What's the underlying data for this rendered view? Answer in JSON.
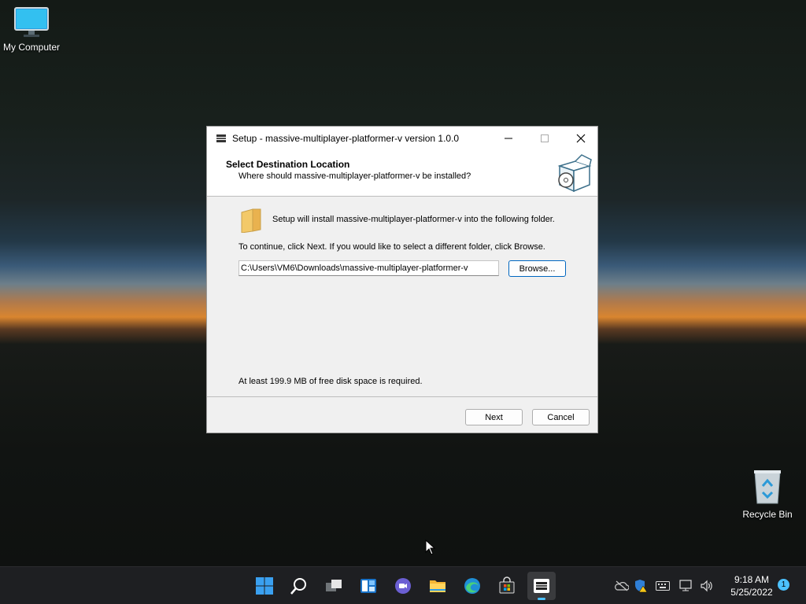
{
  "desktop": {
    "icons": [
      {
        "label": "My Computer",
        "icon": "monitor-icon"
      },
      {
        "label": "Recycle Bin",
        "icon": "recycle-bin-icon"
      }
    ]
  },
  "window": {
    "title": "Setup - massive-multiplayer-platformer-v version 1.0.0",
    "header": {
      "heading": "Select Destination Location",
      "subheading": "Where should massive-multiplayer-platformer-v be installed?"
    },
    "body": {
      "install_text": "Setup will install massive-multiplayer-platformer-v into the following folder.",
      "continue_text": "To continue, click Next. If you would like to select a different folder, click Browse.",
      "path_value": "C:\\Users\\VM6\\Downloads\\massive-multiplayer-platformer-v",
      "browse_label": "Browse...",
      "disk_space_text": "At least 199.9 MB of free disk space is required."
    },
    "footer": {
      "next_label": "Next",
      "cancel_label": "Cancel"
    }
  },
  "taskbar": {
    "apps": [
      "start-icon",
      "search-icon",
      "task-view-icon",
      "widgets-icon",
      "chat-icon",
      "file-explorer-icon",
      "edge-icon",
      "store-icon",
      "setup-app-icon"
    ],
    "clock": {
      "time": "9:18 AM",
      "date": "5/25/2022"
    },
    "notification_count": "1"
  },
  "colors": {
    "accent": "#0067c0",
    "taskbar": "#1e1f22",
    "highlight": "#4cc2ff"
  }
}
